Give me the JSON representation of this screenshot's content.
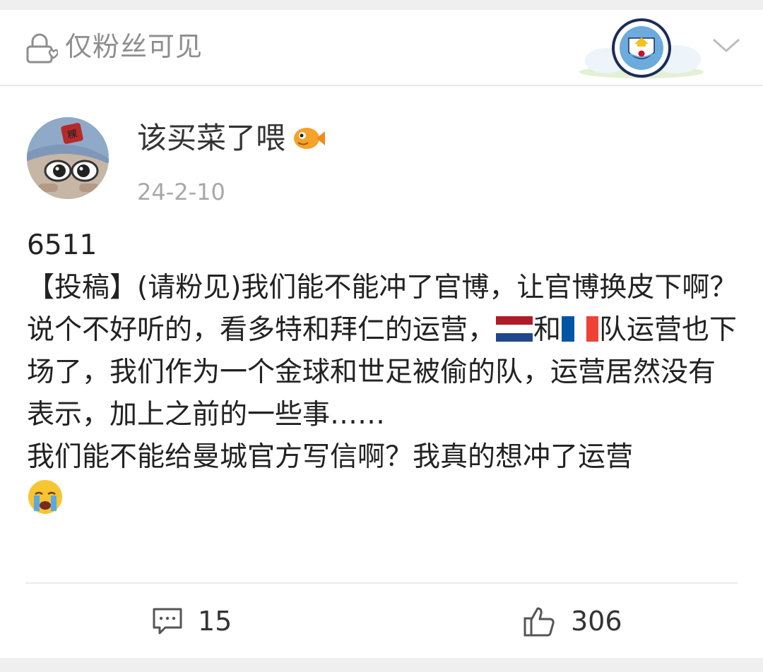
{
  "header": {
    "visibility_label": "仅粉丝可见",
    "badge_icon": "manchester-city-badge-icon",
    "expand_icon": "chevron-down-icon"
  },
  "post": {
    "author": "该买菜了喂",
    "date": "24-2-10",
    "lines": {
      "l1": "6511",
      "l2a": "【投稿】(请粉见)我们能不能冲了官博，让官博换皮下啊？说个不好听的，看多特和拜仁的运营，",
      "l2_and": "和",
      "l2b": "队运营也下场了，我们作为一个金球和世足被偷的队，运营居然没有表示，加上之前的一些事……",
      "l3": "我们能不能给曼城官方写信啊？我真的想冲了运营"
    },
    "emoji": [
      "netherlands-flag-icon",
      "france-flag-icon",
      "crying-face-icon"
    ]
  },
  "actions": {
    "comments_count": "15",
    "likes_count": "306"
  },
  "colors": {
    "muted_text": "#8e8e8e",
    "date_text": "#a8a8a8",
    "badge_blue": "#6cabdd"
  }
}
